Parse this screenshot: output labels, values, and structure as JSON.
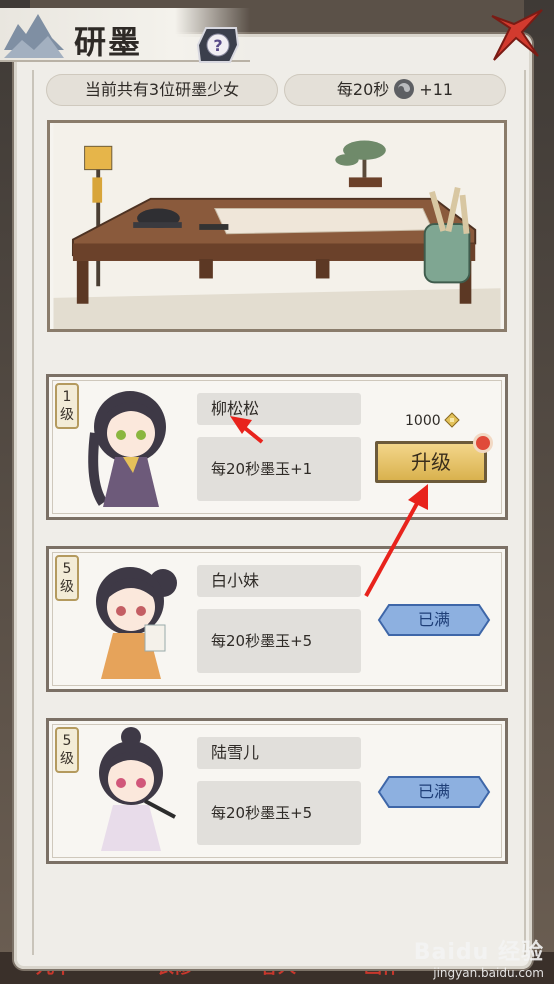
{
  "title": "研墨",
  "info": {
    "girls_count_text": "当前共有3位研墨少女",
    "rate_prefix": "每20秒",
    "rate_suffix": "+11"
  },
  "cards": [
    {
      "level_num": "1",
      "level_unit": "级",
      "name": "柳松松",
      "rate": "每20秒墨玉+1",
      "cost": "1000",
      "button": "升级"
    },
    {
      "level_num": "5",
      "level_unit": "级",
      "name": "白小妹",
      "rate": "每20秒墨玉+5",
      "button": "已满"
    },
    {
      "level_num": "5",
      "level_unit": "级",
      "name": "陆雪儿",
      "rate": "每20秒墨玉+5",
      "button": "已满"
    }
  ],
  "bottom_nav": [
    "九十",
    "衣修",
    "客人",
    "画作"
  ],
  "watermark": {
    "line1": "Baidu 经验",
    "line2": "jingyan.baidu.com"
  },
  "colors": {
    "accent": "#d9b24e",
    "alert": "#e04a3a",
    "full_button": "#8db0e0"
  }
}
